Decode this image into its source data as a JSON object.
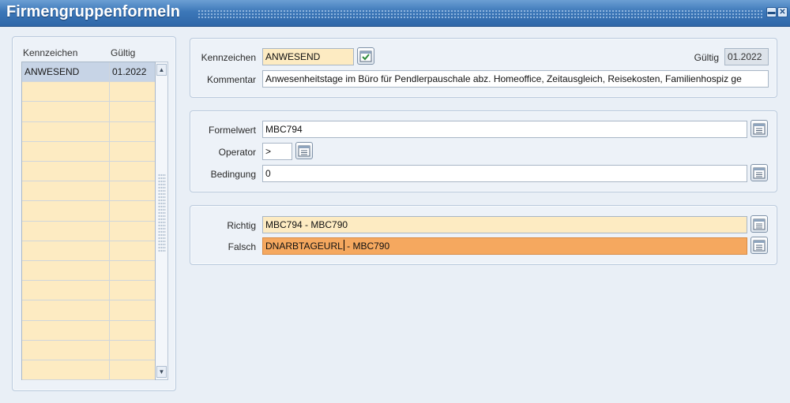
{
  "window": {
    "title": "Firmengruppenformeln",
    "minimize_glyph": "▬",
    "close_glyph": "✕"
  },
  "list": {
    "headers": [
      "Kennzeichen",
      "Gültig"
    ],
    "rows": [
      {
        "kennzeichen": "ANWESEND",
        "gueltig": "01.2022"
      }
    ]
  },
  "header_section": {
    "kennzeichen_label": "Kennzeichen",
    "kennzeichen_value": "ANWESEND",
    "gueltig_label": "Gültig",
    "gueltig_value": "01.2022",
    "kommentar_label": "Kommentar",
    "kommentar_value": "Anwesenheitstage im Büro für Pendlerpauschale abz. Homeoffice, Zeitausgleich, Reisekosten, Familienhospiz ge"
  },
  "condition_section": {
    "formelwert_label": "Formelwert",
    "formelwert_value": "MBC794",
    "operator_label": "Operator",
    "operator_value": ">",
    "bedingung_label": "Bedingung",
    "bedingung_value": "0"
  },
  "result_section": {
    "richtig_label": "Richtig",
    "richtig_value": "MBC794 - MBC790",
    "falsch_label": "Falsch",
    "falsch_value_before_caret": "DNARBTAGEURL",
    "falsch_value_after_caret": " - MBC790"
  },
  "icons": {
    "check": "check-calendar-icon",
    "lookup": "list-lookup-icon"
  },
  "colors": {
    "titlebar": "#3c77b8",
    "field_yellow": "#fdebc2",
    "field_orange": "#f5a85f",
    "selected_row": "#c7d4e6"
  }
}
